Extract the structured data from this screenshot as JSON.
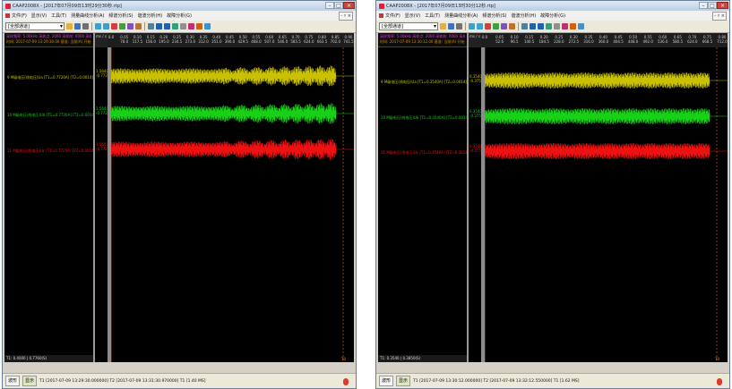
{
  "windows": [
    {
      "title": "CAAP2008X - [2017年07月09日13时29分30秒.rtp]",
      "menu": [
        "文件(F)",
        "显示(V)",
        "工具(T)",
        "测量曲线分析(A)",
        "频谱分析(S)",
        "谐波分析(H)",
        "故障分析(G)"
      ],
      "mdi_button": "- ♯ ×",
      "combo": "[全部通道]",
      "header_line1": "采样频率: 5.00kHz 采样点: 2000 采样前: 0000 采样后: 0",
      "header_line2": "时间: 2017-07-09 13:29:30.00 基准: 当前(A) 开始",
      "channel_labels": [
        "9 M级电压(线电压)Ua [T1=0.7720A] [T2=0.0014]",
        "10 M级电压(线电压)Ub [T1=0.7720A] [T2=0.0014]",
        "11 M级电压(线电压)Uc [T1=0.7720A] [T2=0.0014]"
      ],
      "scale_header": "ms / s",
      "scale_values": [
        [
          "1.5640",
          "-0.7720"
        ],
        [
          "1.5640",
          "-0.7720"
        ],
        [
          "1.5640",
          "-0.7720"
        ]
      ],
      "time_ticks": [
        [
          "0.0",
          "0.05\n78.0"
        ],
        [
          "0.10\n117.5"
        ],
        [
          "0.15\n156.0"
        ],
        [
          "0.20\n195.0"
        ],
        [
          "0.25\n234.5"
        ],
        [
          "0.30\n273.0"
        ],
        [
          "0.35\n312.0"
        ],
        [
          "0.40\n351.0"
        ],
        [
          "0.45\n390.0"
        ],
        [
          "0.50\n429.5"
        ],
        [
          "0.55\n468.0"
        ],
        [
          "0.60\n507.0"
        ],
        [
          "0.65\n546.0"
        ],
        [
          "0.70\n585.5"
        ],
        [
          "0.75\n624.0"
        ],
        [
          "0.80\n663.5"
        ],
        [
          "0.85\n702.0"
        ],
        [
          "0.90\n741.5"
        ]
      ],
      "panel_bottom": "T1: 0.4000 | 0.7760(S)",
      "status_right": "T0",
      "taskbar": {
        "btn1": "波形",
        "btn2": "显示",
        "time": "T1 [2017-07-09 13:29:30.000000]  T2 [2017-07-09 13:31:30.970000]  T1 [1.40 MS]"
      },
      "colors": {
        "ch1": "#c9c000",
        "ch2": "#18d018",
        "ch3": "#ee1111"
      },
      "wave_profile": "left"
    },
    {
      "title": "CAAP2008X - [2017年07月09日13时30分12秒.rtp]",
      "menu": [
        "文件(F)",
        "显示(V)",
        "工具(T)",
        "测量曲线分析(A)",
        "频谱分析(S)",
        "谐波分析(H)",
        "故障分析(G)"
      ],
      "mdi_button": "- ♯ ×",
      "combo": "[全部通道]",
      "header_line1": "采样频率: 5.00kHz 采样点: 2000 采样前: 0000 采样后: 0",
      "header_line2": "时间: 2017-07-09 13:30:12.00 基准: 当前(A) 开始",
      "channel_labels": [
        "9 M级电压(线电压)Ua [T1=0.3540A] [T2=0.0014]",
        "10 M级电压(线电压)Ub [T1=0.3540A] [T2=0.0014]",
        "11 M级电压(线电压)Uc [T1=0.3540A] [T2=0.0014]"
      ],
      "scale_header": "ms / s",
      "scale_values": [
        [
          "0.3540",
          "-0.3750"
        ],
        [
          "0.3540",
          "-0.3750"
        ],
        [
          "0.3540",
          "-0.3750"
        ]
      ],
      "time_ticks": [
        [
          "0.0",
          "0.05\n52.6"
        ],
        [
          "0.10\n96.5"
        ],
        [
          "0.15\n140.5"
        ],
        [
          "0.20\n184.5"
        ],
        [
          "0.25\n228.0"
        ],
        [
          "0.30\n272.5"
        ],
        [
          "0.35\n316.0"
        ],
        [
          "0.40\n360.0"
        ],
        [
          "0.45\n404.5"
        ],
        [
          "0.50\n448.0"
        ],
        [
          "0.55\n492.0"
        ],
        [
          "0.60\n536.0"
        ],
        [
          "0.65\n580.5"
        ],
        [
          "0.70\n624.0"
        ],
        [
          "0.75\n668.5"
        ],
        [
          "0.80\n712.0"
        ]
      ],
      "panel_bottom": "T1: 0.3540 | 0.3850(S)",
      "status_right": "T0",
      "taskbar": {
        "btn1": "波形",
        "btn2": "显示",
        "time": "T1 [2017-07-09 13:30:12.000000]  T2 [2017-07-09 13:32:12.550000]  T1 [1.62 MS]"
      },
      "colors": {
        "ch1": "#c9c000",
        "ch2": "#18d018",
        "ch3": "#ee1111"
      },
      "wave_profile": "right"
    }
  ]
}
